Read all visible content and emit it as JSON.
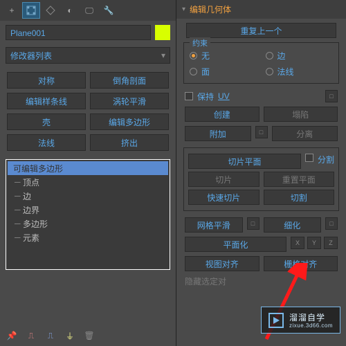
{
  "left": {
    "object_name": "Plane001",
    "modifier_list_label": "修改器列表",
    "buttons": [
      "对称",
      "倒角剖面",
      "编辑样条线",
      "涡轮平滑",
      "壳",
      "编辑多边形",
      "法线",
      "挤出"
    ],
    "tree": {
      "root": "可编辑多边形",
      "items": [
        "顶点",
        "边",
        "边界",
        "多边形",
        "元素"
      ]
    }
  },
  "right": {
    "section_title": "编辑几何体",
    "repeat_btn": "重复上一个",
    "constraint": {
      "title": "约束",
      "options": [
        "无",
        "边",
        "面",
        "法线"
      ],
      "selected": "无"
    },
    "preserve_label": "保持",
    "uv_label": "UV",
    "row1": [
      "创建",
      "塌陷"
    ],
    "row2": [
      "附加",
      "分离"
    ],
    "slice_group": {
      "slice_plane": "切片平面",
      "split_chk": "分割",
      "slice": "切片",
      "reset_plane": "重置平面",
      "quick_slice": "快速切片",
      "cut": "切割"
    },
    "mesh_smooth": "网格平滑",
    "tessellate": "细化",
    "planarize": "平面化",
    "xyz": [
      "X",
      "Y",
      "Z"
    ],
    "view_align": "视图对齐",
    "grid_align": "栅格对齐",
    "hide_sel": "隐藏选定对"
  },
  "watermark": {
    "main": "溜溜自学",
    "sub": "zixue.3d66.com"
  }
}
